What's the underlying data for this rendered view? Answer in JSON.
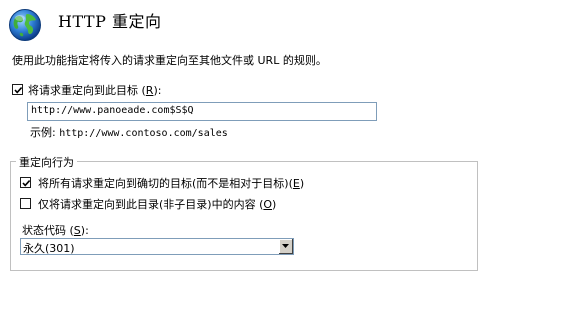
{
  "header": {
    "title": "HTTP 重定向",
    "icon": "globe-icon"
  },
  "description": "使用此功能指定将传入的请求重定向至其他文件或 URL 的规则。",
  "redirect_checkbox": {
    "checked": true,
    "label_prefix": "将请求重定向到此目标 (",
    "accesskey": "R",
    "label_suffix": "):"
  },
  "target_input": {
    "value": "http://www.panoeade.com$S$Q"
  },
  "example": {
    "label": "示例: ",
    "value": "http://www.contoso.com/sales"
  },
  "behavior_group": {
    "title": "重定向行为",
    "exact_destination": {
      "checked": true,
      "label_prefix": "将所有请求重定向到确切的目标(而不是相对于目标)(",
      "accesskey": "E",
      "label_suffix": ")"
    },
    "only_this_directory": {
      "checked": false,
      "label_prefix": "仅将请求重定向到此目录(非子目录)中的内容 (",
      "accesskey": "O",
      "label_suffix": ")"
    },
    "status_code": {
      "label_prefix": "状态代码 (",
      "accesskey": "S",
      "label_suffix": "):",
      "selected": "永久(301)"
    }
  },
  "colors": {
    "input_border": "#7f9db9",
    "group_border": "#c0c0c0",
    "button_face": "#d4d0c8"
  }
}
